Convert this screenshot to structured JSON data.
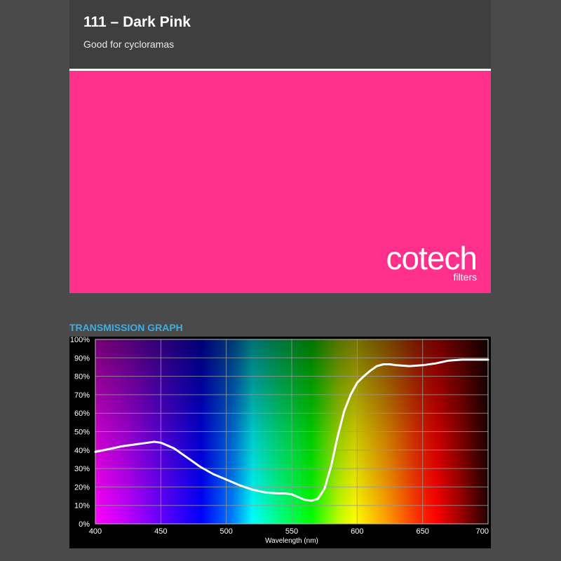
{
  "header": {
    "title": "111 – Dark Pink",
    "subtitle": "Good for cycloramas"
  },
  "swatch": {
    "color": "#ff2f8c"
  },
  "brand": {
    "name": "cotech",
    "sub": "filters"
  },
  "graph": {
    "title": "TRANSMISSION GRAPH",
    "title_color": "#3ab0e2"
  },
  "chart_data": {
    "type": "line",
    "xlabel": "Wavelength (nm)",
    "ylabel": "",
    "xlim": [
      400,
      700
    ],
    "ylim": [
      0,
      100
    ],
    "x_ticks": [
      400,
      450,
      500,
      550,
      600,
      650,
      700
    ],
    "y_ticks": [
      0,
      10,
      20,
      30,
      40,
      50,
      60,
      70,
      80,
      90,
      100
    ],
    "y_tick_suffix": "%",
    "grid": true,
    "background": "visible light spectrum",
    "line_color": "#ffffff",
    "series": [
      {
        "x": [
          400,
          410,
          420,
          430,
          440,
          445,
          450,
          460,
          470,
          480,
          490,
          500,
          510,
          520,
          530,
          540,
          545,
          550,
          555,
          560,
          565,
          570,
          575,
          580,
          585,
          590,
          595,
          600,
          605,
          610,
          615,
          620,
          625,
          630,
          640,
          650,
          660,
          670,
          680,
          690,
          700
        ],
        "y": [
          39,
          40.5,
          42,
          43,
          44,
          44.5,
          44,
          41,
          36,
          31,
          27,
          24,
          21,
          18.5,
          17,
          16.5,
          16.5,
          16,
          14.5,
          13,
          12.5,
          13.5,
          19,
          31,
          47,
          61,
          70,
          76.5,
          80,
          83,
          85.5,
          86.5,
          86.5,
          86,
          85.5,
          86,
          87,
          88.5,
          89,
          89,
          89
        ]
      }
    ]
  }
}
